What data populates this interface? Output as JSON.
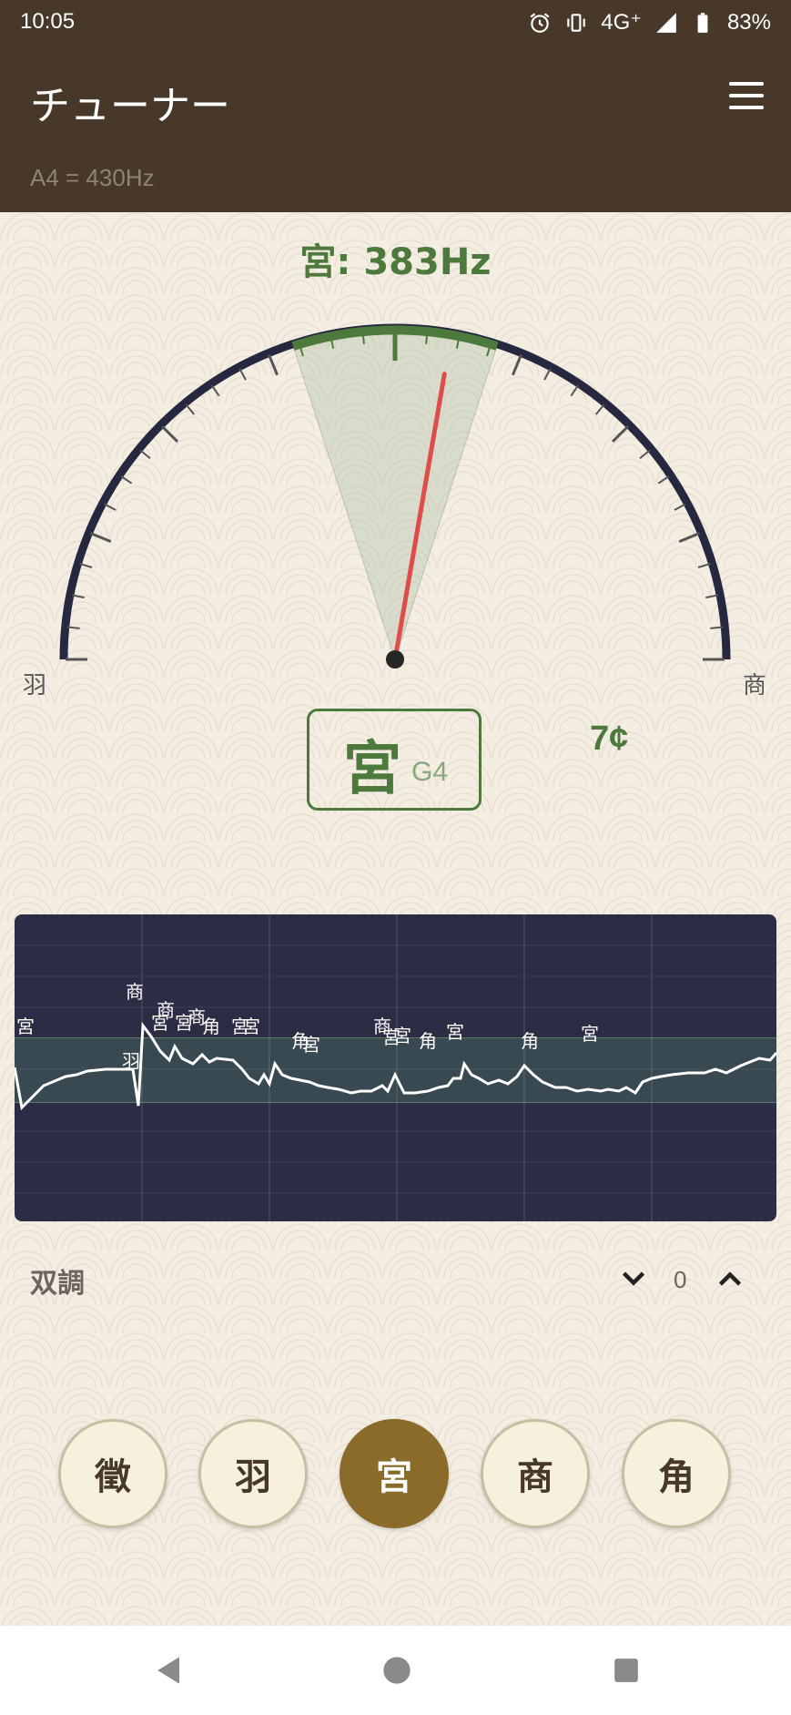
{
  "status": {
    "time": "10:05",
    "network": "4G⁺",
    "battery": "83%"
  },
  "app": {
    "title": "チューナー",
    "reference": "A4 = 430Hz"
  },
  "tuner": {
    "detected": "宮: 383Hz",
    "left_label": "羽",
    "right_label": "商",
    "note_name": "宮",
    "note_western": "G4",
    "cents": "7¢",
    "needle_cents": 7,
    "needle_color": "#e04b4b",
    "accent_color": "#4d7a3c"
  },
  "graph": {
    "labels": [
      "宮",
      "商",
      "羽",
      "商",
      "宮",
      "角",
      "宮",
      "宮",
      "商",
      "宮",
      "角",
      "宮",
      "商",
      "宮",
      "宮",
      "角",
      "宮",
      "角",
      "宮"
    ]
  },
  "mode": {
    "label": "双調",
    "transpose": "0"
  },
  "notes": [
    {
      "label": "徵",
      "active": false
    },
    {
      "label": "羽",
      "active": false
    },
    {
      "label": "宮",
      "active": true
    },
    {
      "label": "商",
      "active": false
    },
    {
      "label": "角",
      "active": false
    }
  ],
  "colors": {
    "header": "#47382a",
    "active_button": "#8a6b2a",
    "graph_bg": "#2c2d45"
  }
}
